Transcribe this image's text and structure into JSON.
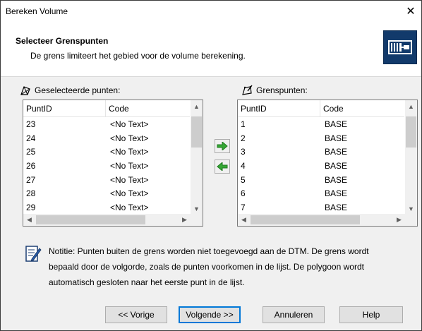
{
  "window": {
    "title": "Bereken Volume",
    "close_glyph": "✕"
  },
  "header": {
    "title": "Selecteer Grenspunten",
    "subtitle": "De grens limiteert het gebied voor de volume berekening.",
    "logo_icon": "boundary-icon",
    "logo_color": "#123a6b"
  },
  "left_panel": {
    "label": "Geselecteerde punten:",
    "icon": "points-icon",
    "columns": [
      "PuntID",
      "Code"
    ],
    "rows": [
      [
        "23",
        "<No Text>"
      ],
      [
        "24",
        "<No Text>"
      ],
      [
        "25",
        "<No Text>"
      ],
      [
        "26",
        "<No Text>"
      ],
      [
        "27",
        "<No Text>"
      ],
      [
        "28",
        "<No Text>"
      ],
      [
        "29",
        "<No Text>"
      ]
    ]
  },
  "right_panel": {
    "label": "Grenspunten:",
    "icon": "boundary-points-icon",
    "columns": [
      "PuntID",
      "Code"
    ],
    "rows": [
      [
        "1",
        "BASE"
      ],
      [
        "2",
        "BASE"
      ],
      [
        "3",
        "BASE"
      ],
      [
        "4",
        "BASE"
      ],
      [
        "5",
        "BASE"
      ],
      [
        "6",
        "BASE"
      ],
      [
        "7",
        "BASE"
      ]
    ]
  },
  "transfer": {
    "add_icon": "arrow-right-icon",
    "remove_icon": "arrow-left-icon",
    "color": "#2ea02e"
  },
  "note": {
    "icon": "notepad-icon",
    "text_lines": [
      "Notitie: Punten buiten de grens worden niet toegevoegd aan de DTM. De grens wordt",
      "bepaald door de volgorde, zoals de punten voorkomen in de lijst. De polygoon wordt",
      "automatisch gesloten naar het eerste punt in de lijst."
    ]
  },
  "buttons": {
    "back": "<< Vorige",
    "next": "Volgende >>",
    "cancel": "Annuleren",
    "help": "Help"
  }
}
